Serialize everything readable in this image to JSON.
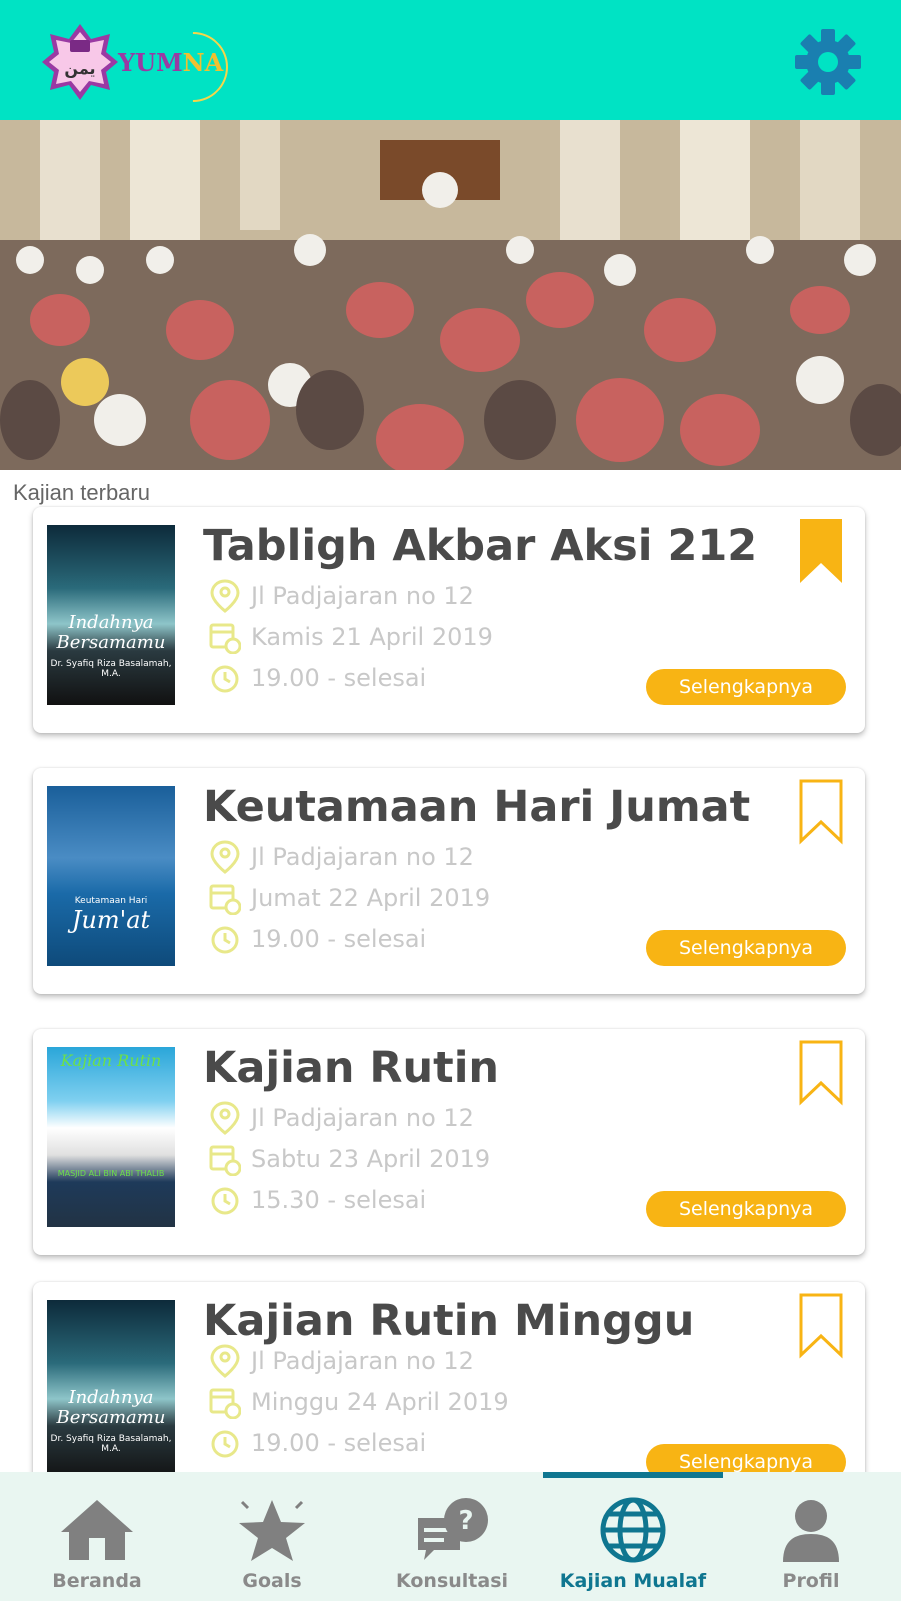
{
  "header": {
    "logo_text_main": "YUM",
    "logo_text_accent": "NA",
    "logo_arabic": "يمن",
    "settings_icon": "gear-icon"
  },
  "banner": {
    "slide_count": 3,
    "active_slide": 1
  },
  "section_title": "Kajian terbaru",
  "cards": [
    {
      "title": "Tabligh Akbar Aksi 212",
      "location": "Jl Padjajaran no 12",
      "date": "Kamis 21 April 2019",
      "time": "19.00 - selesai",
      "button": "Selengkapnya",
      "bookmarked": true,
      "thumb_text": "Indahnya Bersamamu",
      "thumb_caption": "Dr. Syafiq Riza Basalamah, M.A."
    },
    {
      "title": "Keutamaan Hari Jumat",
      "location": "Jl Padjajaran no 12",
      "date": "Jumat 22 April 2019",
      "time": "19.00 - selesai",
      "button": "Selengkapnya",
      "bookmarked": false,
      "thumb_text": "Jum'at",
      "thumb_caption": "Keutamaan Hari"
    },
    {
      "title": "Kajian Rutin",
      "location": "Jl Padjajaran no 12",
      "date": "Sabtu 23 April 2019",
      "time": "15.30 - selesai",
      "button": "Selengkapnya",
      "bookmarked": false,
      "thumb_text": "Kajian Rutin",
      "thumb_caption": "MASJID ALI BIN ABI THALIB"
    },
    {
      "title": "Kajian Rutin Minggu",
      "location": "Jl Padjajaran no 12",
      "date": "Minggu 24 April 2019",
      "time": "19.00 - selesai",
      "button": "Selengkapnya",
      "bookmarked": false,
      "thumb_text": "Indahnya Bersamamu",
      "thumb_caption": "Dr. Syafiq Riza Basalamah, M.A."
    }
  ],
  "nav": [
    {
      "label": "Beranda",
      "icon": "home-icon",
      "active": false
    },
    {
      "label": "Goals",
      "icon": "star-icon",
      "active": false
    },
    {
      "label": "Konsultasi",
      "icon": "chat-question-icon",
      "active": false
    },
    {
      "label": "Kajian Mualaf",
      "icon": "globe-icon",
      "active": true
    },
    {
      "label": "Profil",
      "icon": "user-icon",
      "active": false
    }
  ],
  "colors": {
    "header_bg": "#00e3c4",
    "accent": "#f8b414",
    "nav_active": "#0f7690",
    "nav_bg": "#e9f6f1"
  }
}
